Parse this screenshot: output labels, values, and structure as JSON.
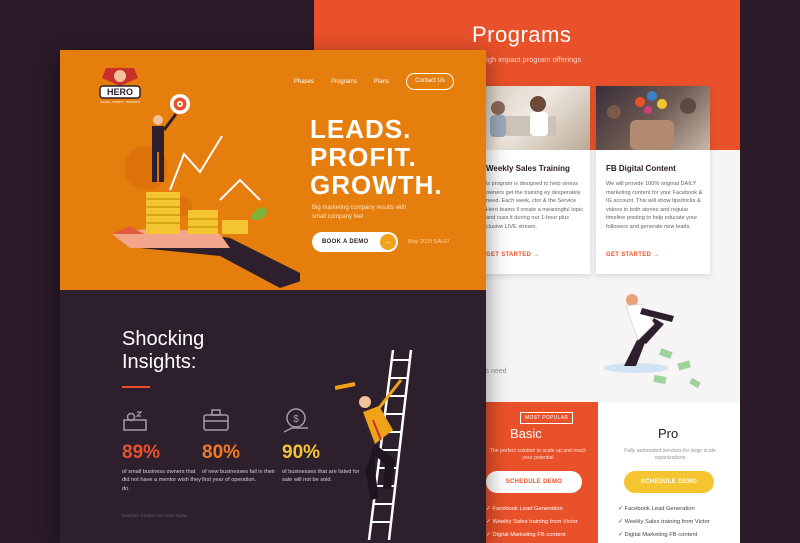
{
  "programs": {
    "title": "Programs",
    "subtitle": "high impact program offerings",
    "cards": [
      {
        "title": "Weekly Sales Training",
        "body": "is program is designed to help siness owners get the training ey desperately need. Each week, ctor & the Service Hero teams ll create a meaningful topic and cuss it during our 1-hour plus clusive LIVE stream.",
        "cta": "GET STARTED  →"
      },
      {
        "title": "FB Digital Content",
        "body": "We will provide 100% original DAILY marketing content for your Facebook & IG account. This will show tips/tricks & videos in both stories and regular timeline posting to help educate your followers and generate new leads.",
        "cta": "GET STARTED  →"
      }
    ],
    "needs_text": "ss need"
  },
  "plans": {
    "basic": {
      "badge": "MOST POPULAR",
      "title": "Basic",
      "desc": "The perfect solution to scale up and reach your potential",
      "cta": "SCHEDULE DEMO",
      "features": [
        "Facebook Lead Generation",
        "Weekly Sales training from Victor",
        "Digital Marketing FB content"
      ]
    },
    "pro": {
      "title": "Pro",
      "desc": "Fully automated services for large scale organizations",
      "cta": "SCHEDULE DEMO",
      "features": [
        "Facebook Lead Generation",
        "Weekly Sales training from Victor",
        "Digital Marketing FB content"
      ]
    }
  },
  "hero": {
    "logo_text": "HERO",
    "logo_sub": "SALES · PROFIT · GROWTH",
    "nav": [
      "Phases",
      "Programs",
      "Plans"
    ],
    "contact": "Contact Us",
    "headline": [
      "LEADS.",
      "PROFIT.",
      "GROWTH."
    ],
    "desc": "Big marketing company results with small company feel",
    "demo": "BOOK A DEMO",
    "demo_arrow": "→",
    "sale": "May 2020 SALE!"
  },
  "insights": {
    "title_line1": "Shocking",
    "title_line2": "Insights:",
    "stats": [
      {
        "icon": "sleeping-owner-icon",
        "value": "89%",
        "desc": "of small business owners that did not have a mentor wish they do."
      },
      {
        "icon": "briefcase-icon",
        "value": "80%",
        "desc": "of new businesses fail in their first year of operation."
      },
      {
        "icon": "money-hand-icon",
        "value": "90%",
        "desc": "of businesses that are listed for sale will not be sold."
      }
    ],
    "source": "Sources: Forbes and USA Today"
  },
  "colors": {
    "orange": "#e67e0d",
    "coral": "#e9512a",
    "dark": "#2e1f2c",
    "yellow": "#f5c531"
  }
}
